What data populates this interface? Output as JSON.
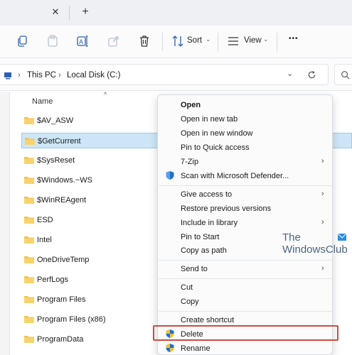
{
  "tabbar": {
    "close_glyph": "✕",
    "new_glyph": "+"
  },
  "toolbar": {
    "icons": [
      "copy-icon",
      "paste-icon",
      "rename-icon",
      "share-icon",
      "delete-icon"
    ],
    "sort_label": "Sort",
    "view_label": "View",
    "more_glyph": "•••"
  },
  "address": {
    "segments": [
      "This PC",
      "Local Disk (C:)"
    ],
    "separator": "›"
  },
  "filelist": {
    "column_name": "Name",
    "items": [
      {
        "name": "$AV_ASW"
      },
      {
        "name": "$GetCurrent",
        "selected": true
      },
      {
        "name": "$SysReset"
      },
      {
        "name": "$Windows.~WS"
      },
      {
        "name": "$WinREAgent"
      },
      {
        "name": "ESD"
      },
      {
        "name": "Intel"
      },
      {
        "name": "OneDriveTemp"
      },
      {
        "name": "PerfLogs"
      },
      {
        "name": "Program Files"
      },
      {
        "name": "Program Files (x86)"
      },
      {
        "name": "ProgramData"
      }
    ]
  },
  "context_menu": {
    "groups": [
      [
        "Open",
        "Open in new tab",
        "Open in new window",
        "Pin to Quick access",
        "7-Zip",
        "Scan with Microsoft Defender..."
      ],
      [
        "Give access to",
        "Restore previous versions",
        "Include in library",
        "Pin to Start",
        "Copy as path"
      ],
      [
        "Send to"
      ],
      [
        "Cut",
        "Copy"
      ],
      [
        "Create shortcut",
        "Delete",
        "Rename"
      ]
    ],
    "highlighted": "Delete"
  },
  "watermark": {
    "line1": "The",
    "line2": "WindowsClub"
  },
  "colors": {
    "selection": "#cde6f7",
    "folder": "#f4c14e",
    "highlight_border": "#d04a42",
    "accent_blue": "#1f6fd1"
  }
}
